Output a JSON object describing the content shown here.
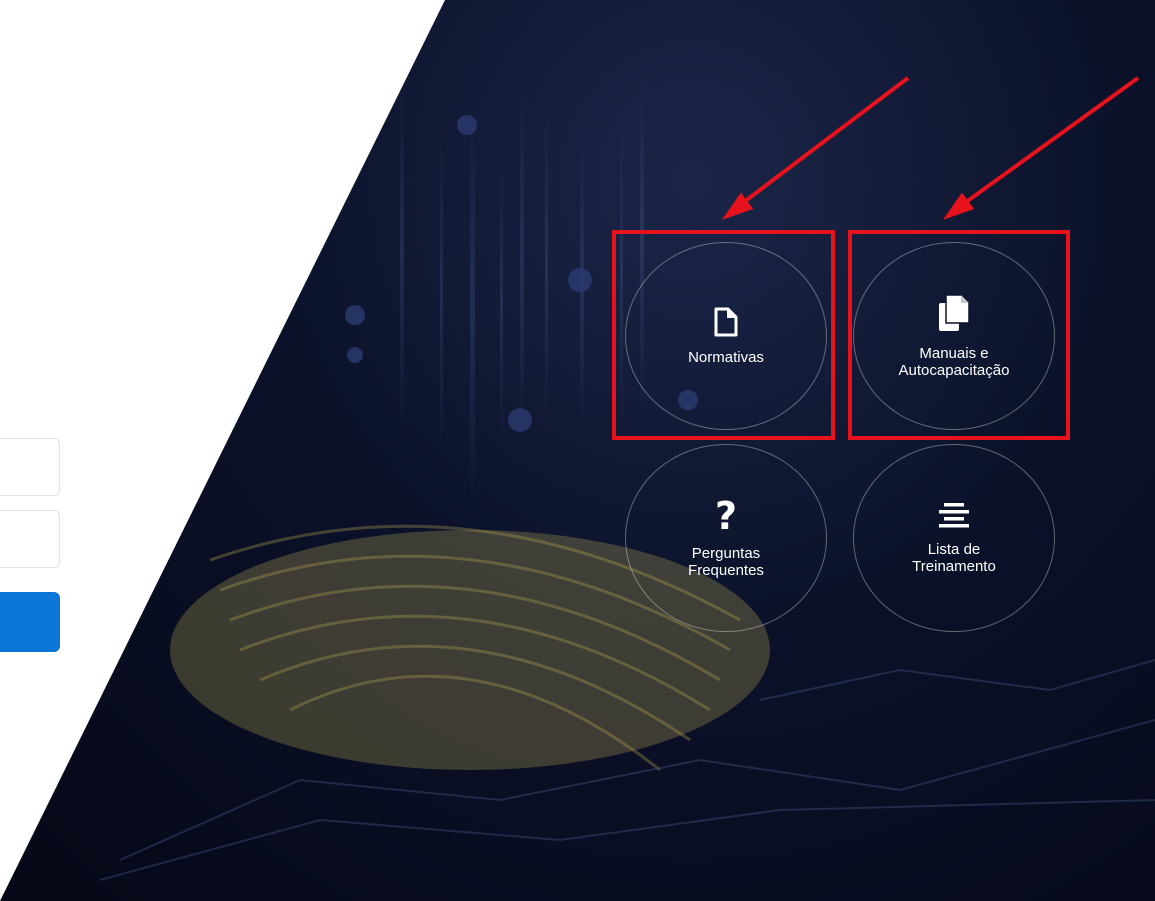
{
  "menu": {
    "items": [
      {
        "label": "Normativas",
        "icon": "document-icon"
      },
      {
        "label": "Manuais e\nAutocapacitação",
        "icon": "documents-copy-icon"
      },
      {
        "label": "Perguntas\nFrequentes",
        "icon": "question-icon"
      },
      {
        "label": "Lista de\nTreinamento",
        "icon": "align-center-icon"
      }
    ]
  },
  "colors": {
    "accent_button": "#0b76d8",
    "annotation_red": "#e8121c",
    "dark_background": "#0b1129"
  }
}
